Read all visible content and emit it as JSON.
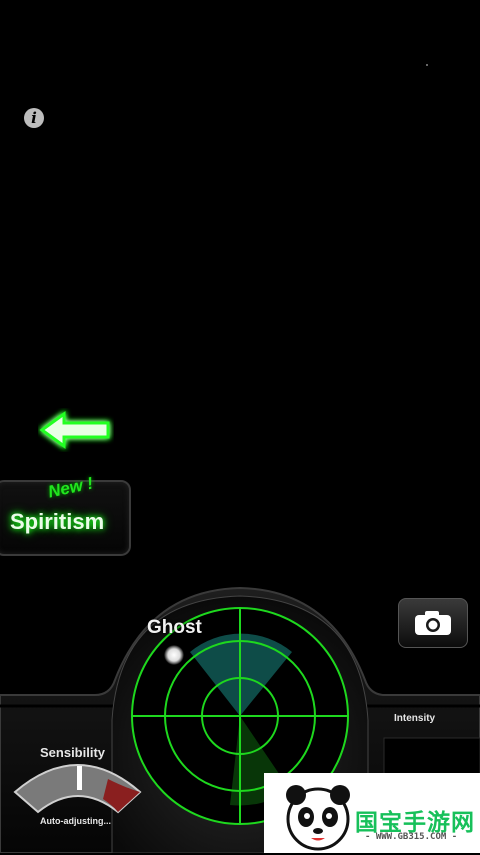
{
  "info": {
    "label": "i"
  },
  "spiritism": {
    "badge": "New !",
    "label": "Spiritism"
  },
  "radar": {
    "ghost_label": "Ghost"
  },
  "intensity": {
    "label": "Intensity"
  },
  "sensibility": {
    "label": "Sensibility",
    "status": "Auto-adjusting..."
  },
  "watermark": {
    "brand": "国宝手游网",
    "url": "- WWW.GB315.COM -"
  },
  "colors": {
    "radar_green": "#1ed81e",
    "text_glow": "#23ff23",
    "sweep": "#1fa9a0",
    "gauge_red": "#8a1f1f"
  },
  "icons": [
    "info-icon",
    "back-arrow-icon",
    "camera-icon",
    "panda-logo-icon"
  ]
}
